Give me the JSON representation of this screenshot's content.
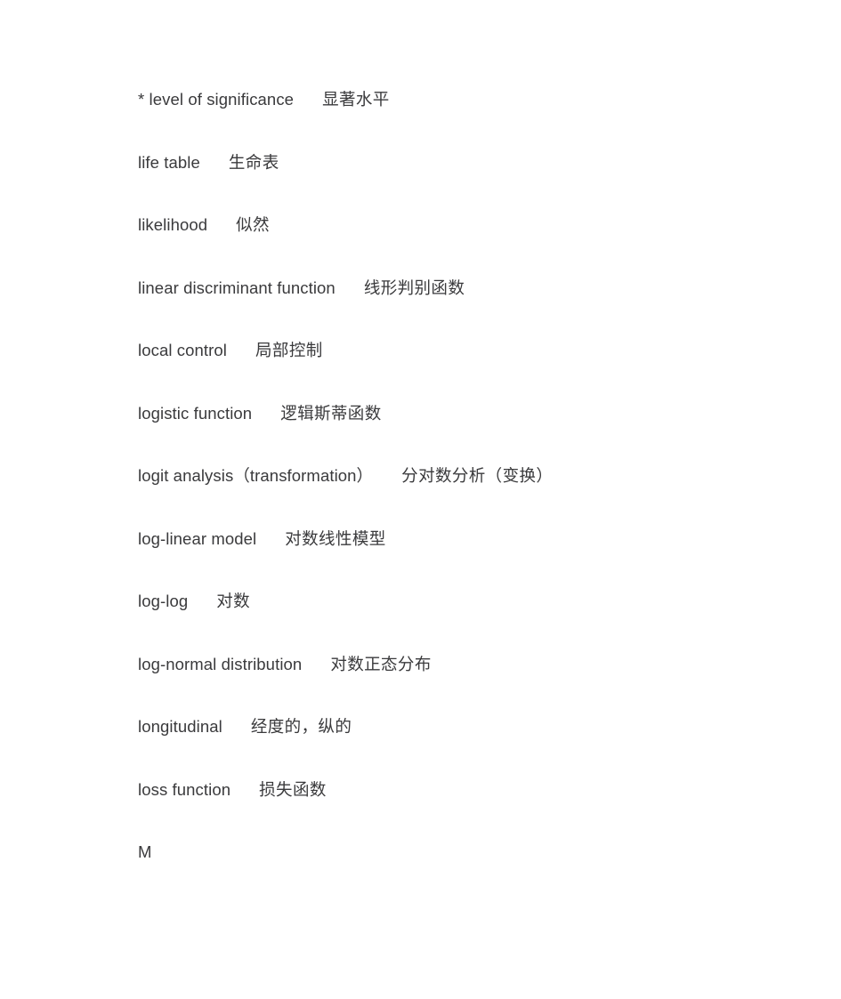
{
  "document": {
    "type": "bilingual-glossary",
    "text_color": "#3a3a3c",
    "background_color": "#ffffff",
    "section_letter": "M",
    "entries": [
      {
        "en": "* level of significance",
        "zh": "显著水平"
      },
      {
        "en": "life table",
        "zh": "生命表"
      },
      {
        "en": "likelihood",
        "zh": "似然"
      },
      {
        "en": "linear discriminant function",
        "zh": "线形判别函数"
      },
      {
        "en": "local control",
        "zh": "局部控制"
      },
      {
        "en": "logistic function",
        "zh": "逻辑斯蒂函数"
      },
      {
        "en": "logit analysis（transformation）",
        "zh": "分对数分析（变换）"
      },
      {
        "en": "log-linear model",
        "zh": "对数线性模型"
      },
      {
        "en": "log-log",
        "zh": "对数"
      },
      {
        "en": "log-normal distribution",
        "zh": "对数正态分布"
      },
      {
        "en": "longitudinal",
        "zh": "经度的，纵的"
      },
      {
        "en": "loss function",
        "zh": "损失函数"
      }
    ]
  }
}
